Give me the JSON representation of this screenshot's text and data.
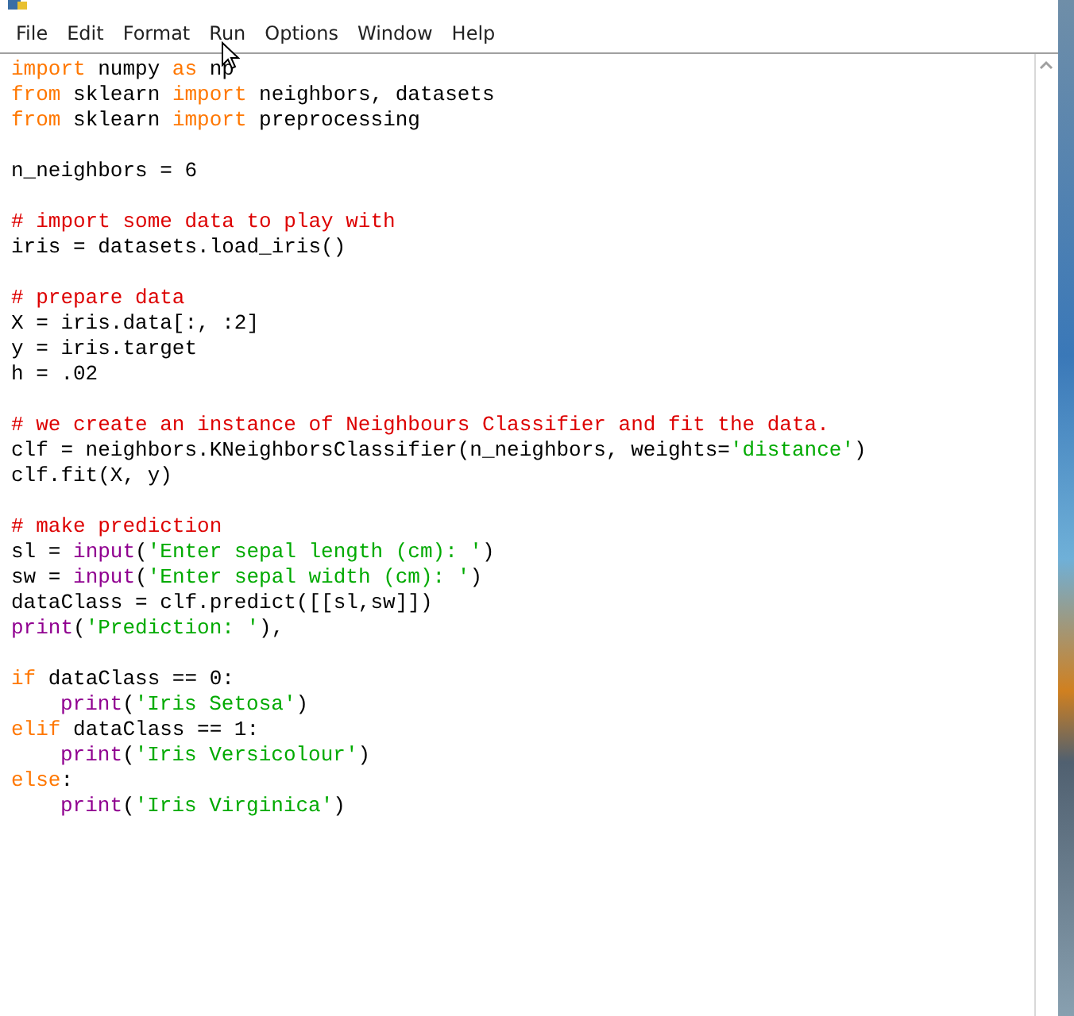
{
  "menu": [
    {
      "label": "File"
    },
    {
      "label": "Edit"
    },
    {
      "label": "Format"
    },
    {
      "label": "Run"
    },
    {
      "label": "Options"
    },
    {
      "label": "Window"
    },
    {
      "label": "Help"
    }
  ],
  "editor": {
    "lines": [
      {
        "kind": "code",
        "indented": false,
        "tokens": [
          {
            "kind": "keyword",
            "text": "import"
          },
          {
            "kind": "plain",
            "text": " numpy "
          },
          {
            "kind": "keyword",
            "text": "as"
          },
          {
            "kind": "plain",
            "text": " np"
          }
        ]
      },
      {
        "kind": "code",
        "indented": false,
        "tokens": [
          {
            "kind": "keyword",
            "text": "from"
          },
          {
            "kind": "plain",
            "text": " sklearn "
          },
          {
            "kind": "keyword",
            "text": "import"
          },
          {
            "kind": "plain",
            "text": " neighbors, datasets"
          }
        ]
      },
      {
        "kind": "code",
        "indented": false,
        "tokens": [
          {
            "kind": "keyword",
            "text": "from"
          },
          {
            "kind": "plain",
            "text": " sklearn "
          },
          {
            "kind": "keyword",
            "text": "import"
          },
          {
            "kind": "plain",
            "text": " preprocessing"
          }
        ]
      },
      {
        "kind": "blank"
      },
      {
        "kind": "code",
        "indented": false,
        "tokens": [
          {
            "kind": "plain",
            "text": "n_neighbors = 6"
          }
        ]
      },
      {
        "kind": "blank"
      },
      {
        "kind": "code",
        "indented": false,
        "tokens": [
          {
            "kind": "comment",
            "text": "# import some data to play with"
          }
        ]
      },
      {
        "kind": "code",
        "indented": false,
        "tokens": [
          {
            "kind": "plain",
            "text": "iris = datasets.load_iris()"
          }
        ]
      },
      {
        "kind": "blank"
      },
      {
        "kind": "code",
        "indented": false,
        "tokens": [
          {
            "kind": "comment",
            "text": "# prepare data"
          }
        ]
      },
      {
        "kind": "code",
        "indented": false,
        "tokens": [
          {
            "kind": "plain",
            "text": "X = iris.data[:, :2]"
          }
        ]
      },
      {
        "kind": "code",
        "indented": false,
        "tokens": [
          {
            "kind": "plain",
            "text": "y = iris.target"
          }
        ]
      },
      {
        "kind": "code",
        "indented": false,
        "tokens": [
          {
            "kind": "plain",
            "text": "h = .02"
          }
        ]
      },
      {
        "kind": "blank"
      },
      {
        "kind": "code",
        "indented": false,
        "tokens": [
          {
            "kind": "comment",
            "text": "# we create an instance of Neighbours Classifier and fit the data."
          }
        ]
      },
      {
        "kind": "code",
        "indented": false,
        "tokens": [
          {
            "kind": "plain",
            "text": "clf = neighbors.KNeighborsClassifier(n_neighbors, weights="
          },
          {
            "kind": "string",
            "text": "'distance'"
          },
          {
            "kind": "plain",
            "text": ")"
          }
        ]
      },
      {
        "kind": "code",
        "indented": false,
        "tokens": [
          {
            "kind": "plain",
            "text": "clf.fit(X, y)"
          }
        ]
      },
      {
        "kind": "blank"
      },
      {
        "kind": "code",
        "indented": false,
        "tokens": [
          {
            "kind": "comment",
            "text": "# make prediction"
          }
        ]
      },
      {
        "kind": "code",
        "indented": false,
        "tokens": [
          {
            "kind": "plain",
            "text": "sl = "
          },
          {
            "kind": "builtin",
            "text": "input"
          },
          {
            "kind": "plain",
            "text": "("
          },
          {
            "kind": "string",
            "text": "'Enter sepal length (cm): '"
          },
          {
            "kind": "plain",
            "text": ")"
          }
        ]
      },
      {
        "kind": "code",
        "indented": false,
        "tokens": [
          {
            "kind": "plain",
            "text": "sw = "
          },
          {
            "kind": "builtin",
            "text": "input"
          },
          {
            "kind": "plain",
            "text": "("
          },
          {
            "kind": "string",
            "text": "'Enter sepal width (cm): '"
          },
          {
            "kind": "plain",
            "text": ")"
          }
        ]
      },
      {
        "kind": "code",
        "indented": false,
        "tokens": [
          {
            "kind": "plain",
            "text": "dataClass = clf.predict([[sl,sw]])"
          }
        ]
      },
      {
        "kind": "code",
        "indented": false,
        "tokens": [
          {
            "kind": "builtin",
            "text": "print"
          },
          {
            "kind": "plain",
            "text": "("
          },
          {
            "kind": "string",
            "text": "'Prediction: '"
          },
          {
            "kind": "plain",
            "text": "),"
          }
        ]
      },
      {
        "kind": "blank"
      },
      {
        "kind": "code",
        "indented": false,
        "tokens": [
          {
            "kind": "keyword",
            "text": "if"
          },
          {
            "kind": "plain",
            "text": " dataClass == 0:"
          }
        ]
      },
      {
        "kind": "code",
        "indented": true,
        "tokens": [
          {
            "kind": "builtin",
            "text": "print"
          },
          {
            "kind": "plain",
            "text": "("
          },
          {
            "kind": "string",
            "text": "'Iris Setosa'"
          },
          {
            "kind": "plain",
            "text": ")"
          }
        ]
      },
      {
        "kind": "code",
        "indented": false,
        "tokens": [
          {
            "kind": "keyword",
            "text": "elif"
          },
          {
            "kind": "plain",
            "text": " dataClass == 1:"
          }
        ]
      },
      {
        "kind": "code",
        "indented": true,
        "tokens": [
          {
            "kind": "builtin",
            "text": "print"
          },
          {
            "kind": "plain",
            "text": "("
          },
          {
            "kind": "string",
            "text": "'Iris Versicolour'"
          },
          {
            "kind": "plain",
            "text": ")"
          }
        ]
      },
      {
        "kind": "code",
        "indented": false,
        "tokens": [
          {
            "kind": "keyword",
            "text": "else"
          },
          {
            "kind": "plain",
            "text": ":"
          }
        ]
      },
      {
        "kind": "code",
        "indented": true,
        "tokens": [
          {
            "kind": "builtin",
            "text": "print"
          },
          {
            "kind": "plain",
            "text": "("
          },
          {
            "kind": "string",
            "text": "'Iris Virginica'"
          },
          {
            "kind": "plain",
            "text": ")"
          }
        ]
      }
    ]
  }
}
